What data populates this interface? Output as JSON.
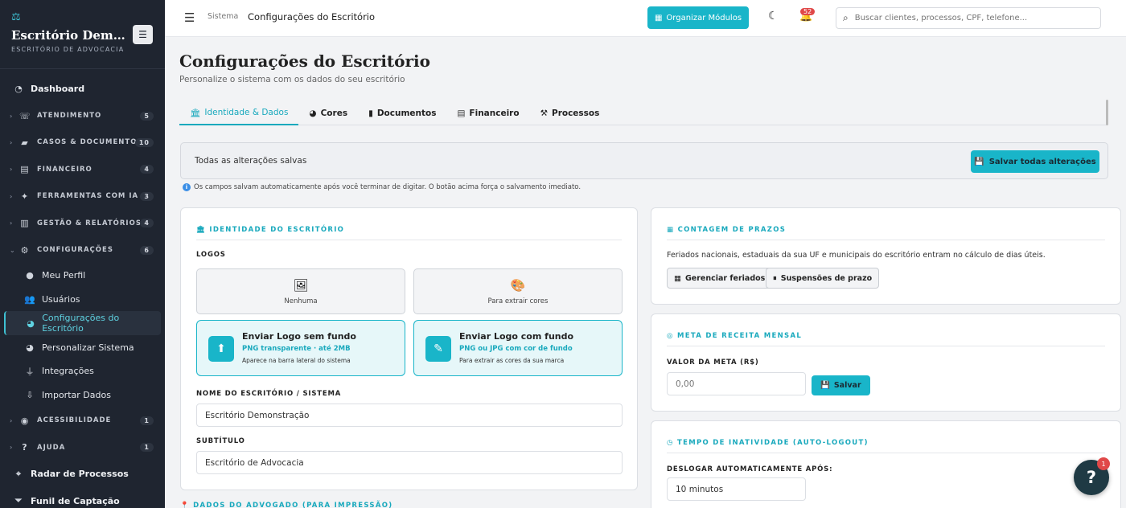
{
  "sidebar": {
    "brand_title": "Escritório Dem…",
    "brand_subtitle": "ESCRITÓRIO DE ADVOCACIA",
    "items": [
      {
        "kind": "top",
        "icon": "◔",
        "icon_name": "dashboard-icon",
        "label": "Dashboard"
      },
      {
        "kind": "group",
        "icon": "☏",
        "icon_name": "headset-icon",
        "label": "ATENDIMENTO",
        "badge": "5"
      },
      {
        "kind": "group",
        "icon": "▰",
        "icon_name": "folder-icon",
        "label": "CASOS & DOCUMENTOS",
        "badge": "10"
      },
      {
        "kind": "group",
        "icon": "▤",
        "icon_name": "coins-icon",
        "label": "FINANCEIRO",
        "badge": "4"
      },
      {
        "kind": "group",
        "icon": "✦",
        "icon_name": "magic-wand-icon",
        "label": "FERRAMENTAS COM IA",
        "badge": "3"
      },
      {
        "kind": "group",
        "icon": "▥",
        "icon_name": "chart-icon",
        "label": "GESTÃO & RELATÓRIOS",
        "badge": "4"
      },
      {
        "kind": "group-open",
        "icon": "⚙",
        "icon_name": "gear-icon",
        "label": "CONFIGURAÇÕES",
        "badge": "6"
      },
      {
        "kind": "sub",
        "icon": "●",
        "icon_name": "user-circle-icon",
        "label": "Meu Perfil"
      },
      {
        "kind": "sub",
        "icon": "👥",
        "icon_name": "users-icon",
        "label": "Usuários"
      },
      {
        "kind": "sub-active",
        "icon": "◕",
        "icon_name": "palette-icon",
        "label": "Configurações do Escritório"
      },
      {
        "kind": "sub",
        "icon": "◕",
        "icon_name": "paint-icon",
        "label": "Personalizar Sistema"
      },
      {
        "kind": "sub",
        "icon": "⏚",
        "icon_name": "plug-icon",
        "label": "Integrações"
      },
      {
        "kind": "sub",
        "icon": "⇩",
        "icon_name": "file-import-icon",
        "label": "Importar Dados"
      },
      {
        "kind": "group",
        "icon": "◉",
        "icon_name": "accessibility-icon",
        "label": "ACESSIBILIDADE",
        "badge": "1"
      },
      {
        "kind": "group",
        "icon": "?",
        "icon_name": "help-icon",
        "label": "AJUDA",
        "badge": "1"
      },
      {
        "kind": "top",
        "icon": "⌖",
        "icon_name": "radar-icon",
        "label": "Radar de Processos"
      },
      {
        "kind": "top",
        "icon": "⏷",
        "icon_name": "funnel-icon",
        "label": "Funil de Captação"
      }
    ]
  },
  "topbar": {
    "breadcrumb": "Sistema",
    "current": "Configurações do Escritório",
    "organize_label": "Organizar Módulos",
    "notifications_count": "52",
    "search_placeholder": "Buscar clientes, processos, CPF, telefone..."
  },
  "page": {
    "title": "Configurações do Escritório",
    "subtitle": "Personalize o sistema com os dados do seu escritório"
  },
  "tabs": [
    {
      "icon": "🏛",
      "icon_name": "building-icon",
      "label": "Identidade & Dados",
      "active": true
    },
    {
      "icon": "◕",
      "icon_name": "palette-icon",
      "label": "Cores"
    },
    {
      "icon": "▮",
      "icon_name": "document-icon",
      "label": "Documentos"
    },
    {
      "icon": "▤",
      "icon_name": "coins-icon",
      "label": "Financeiro"
    },
    {
      "icon": "⚒",
      "icon_name": "gavel-icon",
      "label": "Processos"
    }
  ],
  "save_bar": {
    "status": "Todas as alterações salvas",
    "save_all_label": "Salvar todas alterações",
    "info": "Os campos salvam automaticamente após você terminar de digitar. O botão acima força o salvamento imediato."
  },
  "identity": {
    "title": "IDENTIDADE DO ESCRITÓRIO",
    "logos_label": "LOGOS",
    "logo_preview_none": "Nenhuma",
    "logo_preview_colors": "Para extrair cores",
    "upload_transparent": {
      "title": "Enviar Logo sem fundo",
      "hint": "PNG transparente · até 2MB",
      "note": "Aparece na barra lateral do sistema"
    },
    "upload_background": {
      "title": "Enviar Logo com fundo",
      "hint": "PNG ou JPG com cor de fundo",
      "note": "Para extrair as cores da sua marca"
    },
    "name_label": "NOME DO ESCRITÓRIO / SISTEMA",
    "name_value": "Escritório Demonstração",
    "subtitle_label": "SUBTÍTULO",
    "subtitle_value": "Escritório de Advocacia",
    "next_section": "DADOS DO ADVOGADO (PARA IMPRESSÃO)"
  },
  "deadlines": {
    "title": "CONTAGEM DE PRAZOS",
    "description": "Feriados nacionais, estaduais da sua UF e municipais do escritório entram no cálculo de dias úteis.",
    "manage_holidays": "Gerenciar feriados",
    "suspensions": "Suspensões de prazo"
  },
  "revenue_goal": {
    "title": "META DE RECEITA MENSAL",
    "label": "VALOR DA META (R$)",
    "placeholder": "0,00",
    "save_label": "Salvar"
  },
  "inactivity": {
    "title": "TEMPO DE INATIVIDADE (AUTO-LOGOUT)",
    "label": "DESLOGAR AUTOMATICAMENTE APÓS:",
    "value": "10 minutos"
  },
  "help": {
    "label": "?",
    "badge": "1"
  }
}
